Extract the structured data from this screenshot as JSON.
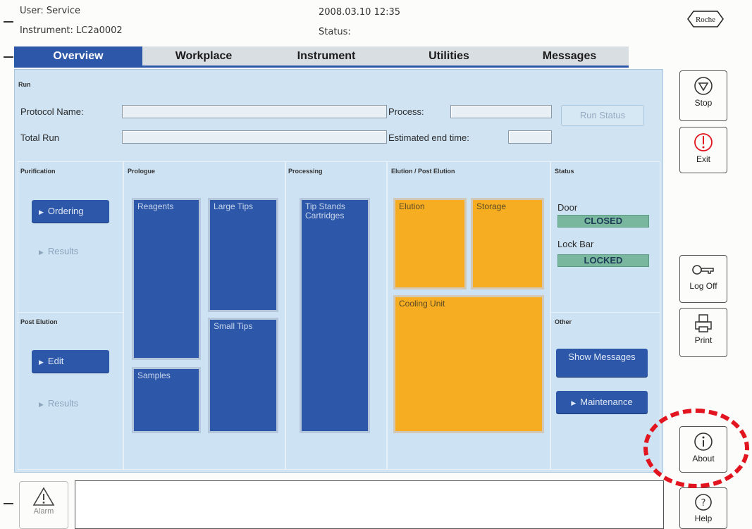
{
  "header": {
    "user": "User: Service",
    "instrument": "Instrument: LC2a0002",
    "datetime": "2008.03.10 12:35",
    "status": "Status:",
    "logo": "Roche"
  },
  "tabs": [
    {
      "label": "Overview",
      "active": true
    },
    {
      "label": "Workplace",
      "active": false
    },
    {
      "label": "Instrument",
      "active": false
    },
    {
      "label": "Utilities",
      "active": false
    },
    {
      "label": "Messages",
      "active": false
    }
  ],
  "run": {
    "section": "Run",
    "protocol_name_label": "Protocol Name:",
    "total_run_label": "Total Run",
    "process_label": "Process:",
    "estimated_end_label": "Estimated end time:",
    "run_status_button": "Run Status"
  },
  "purification": {
    "title": "Purification",
    "ordering": "Ordering",
    "results": "Results"
  },
  "post_elution": {
    "title": "Post Elution",
    "edit": "Edit",
    "results": "Results"
  },
  "prologue": {
    "title": "Prologue",
    "reagents": "Reagents",
    "large_tips": "Large Tips",
    "samples": "Samples",
    "small_tips": "Small Tips"
  },
  "processing": {
    "title": "Processing",
    "tip_stands": "Tip Stands Cartridges"
  },
  "elution": {
    "title": "Elution / Post Elution",
    "elution": "Elution",
    "storage": "Storage",
    "cooling_unit": "Cooling Unit"
  },
  "status_panel": {
    "title": "Status",
    "door_label": "Door",
    "door_value": "CLOSED",
    "lockbar_label": "Lock Bar",
    "lockbar_value": "LOCKED"
  },
  "other": {
    "title": "Other",
    "show_messages": "Show Messages",
    "maintenance": "Maintenance"
  },
  "side_buttons": {
    "stop": "Stop",
    "exit": "Exit",
    "logoff": "Log Off",
    "print": "Print",
    "about": "About",
    "help": "Help"
  },
  "alarm": {
    "label": "Alarm"
  },
  "colors": {
    "blue": "#2d57a8",
    "orange": "#f6ad22",
    "panel": "#cde2f2",
    "status_green": "#79b79e",
    "highlight_red": "#e2141f"
  }
}
